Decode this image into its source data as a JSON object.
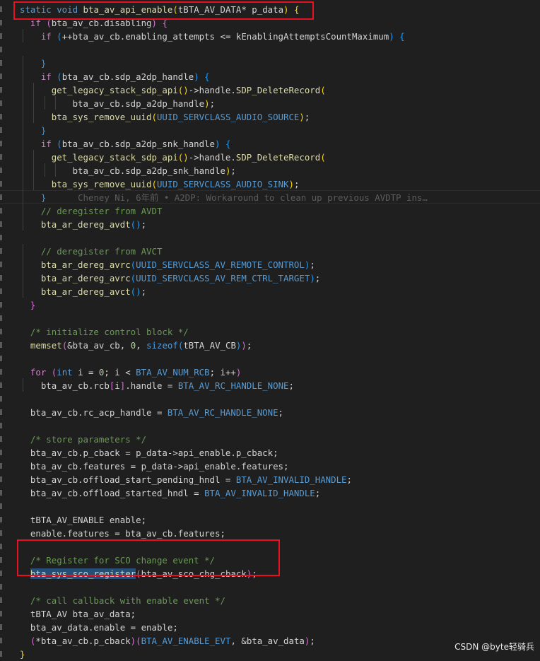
{
  "colors": {
    "background": "#1f1f1f",
    "text": "#d4d4d4",
    "keyword": "#569cd6",
    "control": "#c586c0",
    "function": "#dcdcaa",
    "comment": "#6a9955",
    "number": "#b5cea8",
    "macro": "#4fc1ff",
    "bracket1": "#ffd700",
    "bracket2": "#da70d6",
    "bracket3": "#179fff",
    "blame": "#5c5c5c",
    "annotation_box": "#e81123",
    "selection": "#264f78"
  },
  "code_lines": [
    [
      {
        "t": "static ",
        "c": "keyword"
      },
      {
        "t": "void ",
        "c": "keyword"
      },
      {
        "t": "bta_av_api_enable",
        "c": "function"
      },
      {
        "t": "(",
        "c": "bracket1"
      },
      {
        "t": "tBTA_AV_DATA",
        "c": "text"
      },
      {
        "t": "* p_data",
        "c": "text"
      },
      {
        "t": ")",
        "c": "bracket1"
      },
      {
        "t": " {",
        "c": "bracket1"
      }
    ],
    [
      {
        "t": "  if ",
        "c": "control"
      },
      {
        "t": "(",
        "c": "bracket2"
      },
      {
        "t": "bta_av_cb.disabling",
        "c": "text"
      },
      {
        "t": ") {",
        "c": "bracket2"
      }
    ],
    [
      {
        "t": "    if ",
        "c": "control"
      },
      {
        "t": "(",
        "c": "bracket3"
      },
      {
        "t": "++bta_av_cb.enabling_attempts <= kEnablingAttemptsCountMaximum",
        "c": "text"
      },
      {
        "t": ")",
        "c": "bracket3"
      },
      {
        "t": " {",
        "c": "bracket3"
      }
    ],
    [
      {
        "t": "",
        "c": "text"
      }
    ],
    [
      {
        "t": "    }",
        "c": "bracket3"
      }
    ],
    [
      {
        "t": "    if ",
        "c": "control"
      },
      {
        "t": "(",
        "c": "bracket3"
      },
      {
        "t": "bta_av_cb.sdp_a2dp_handle",
        "c": "text"
      },
      {
        "t": ")",
        "c": "bracket3"
      },
      {
        "t": " {",
        "c": "bracket3"
      }
    ],
    [
      {
        "t": "      get_legacy_stack_sdp_api",
        "c": "function"
      },
      {
        "t": "()",
        "c": "bracket1"
      },
      {
        "t": "->handle.",
        "c": "text"
      },
      {
        "t": "SDP_DeleteRecord",
        "c": "function"
      },
      {
        "t": "(",
        "c": "bracket1"
      }
    ],
    [
      {
        "t": "          bta_av_cb.sdp_a2dp_handle",
        "c": "text"
      },
      {
        "t": ")",
        "c": "bracket1"
      },
      {
        "t": ";",
        "c": "text"
      }
    ],
    [
      {
        "t": "      bta_sys_remove_uuid",
        "c": "function"
      },
      {
        "t": "(",
        "c": "bracket1"
      },
      {
        "t": "UUID_SERVCLASS_AUDIO_SOURCE",
        "c": "keyword"
      },
      {
        "t": ")",
        "c": "bracket1"
      },
      {
        "t": ";",
        "c": "text"
      }
    ],
    [
      {
        "t": "    }",
        "c": "bracket3"
      }
    ],
    [
      {
        "t": "    if ",
        "c": "control"
      },
      {
        "t": "(",
        "c": "bracket3"
      },
      {
        "t": "bta_av_cb.sdp_a2dp_snk_handle",
        "c": "text"
      },
      {
        "t": ")",
        "c": "bracket3"
      },
      {
        "t": " {",
        "c": "bracket3"
      }
    ],
    [
      {
        "t": "      get_legacy_stack_sdp_api",
        "c": "function"
      },
      {
        "t": "()",
        "c": "bracket1"
      },
      {
        "t": "->handle.",
        "c": "text"
      },
      {
        "t": "SDP_DeleteRecord",
        "c": "function"
      },
      {
        "t": "(",
        "c": "bracket1"
      }
    ],
    [
      {
        "t": "          bta_av_cb.sdp_a2dp_snk_handle",
        "c": "text"
      },
      {
        "t": ")",
        "c": "bracket1"
      },
      {
        "t": ";",
        "c": "text"
      }
    ],
    [
      {
        "t": "      bta_sys_remove_uuid",
        "c": "function"
      },
      {
        "t": "(",
        "c": "bracket1"
      },
      {
        "t": "UUID_SERVCLASS_AUDIO_SINK",
        "c": "keyword"
      },
      {
        "t": ")",
        "c": "bracket1"
      },
      {
        "t": ";",
        "c": "text"
      }
    ],
    [
      {
        "t": "    }",
        "c": "bracket3"
      },
      {
        "t": "      Cheney Ni, 6年前 • A2DP: Workaround to clean up previous AVDTP ins…",
        "c": "blame"
      }
    ],
    [
      {
        "t": "    // deregister from AVDT",
        "c": "comment"
      }
    ],
    [
      {
        "t": "    bta_ar_dereg_avdt",
        "c": "function"
      },
      {
        "t": "()",
        "c": "bracket3"
      },
      {
        "t": ";",
        "c": "text"
      }
    ],
    [
      {
        "t": "",
        "c": "text"
      }
    ],
    [
      {
        "t": "    // deregister from AVCT",
        "c": "comment"
      }
    ],
    [
      {
        "t": "    bta_ar_dereg_avrc",
        "c": "function"
      },
      {
        "t": "(",
        "c": "bracket3"
      },
      {
        "t": "UUID_SERVCLASS_AV_REMOTE_CONTROL",
        "c": "keyword"
      },
      {
        "t": ")",
        "c": "bracket3"
      },
      {
        "t": ";",
        "c": "text"
      }
    ],
    [
      {
        "t": "    bta_ar_dereg_avrc",
        "c": "function"
      },
      {
        "t": "(",
        "c": "bracket3"
      },
      {
        "t": "UUID_SERVCLASS_AV_REM_CTRL_TARGET",
        "c": "keyword"
      },
      {
        "t": ")",
        "c": "bracket3"
      },
      {
        "t": ";",
        "c": "text"
      }
    ],
    [
      {
        "t": "    bta_ar_dereg_avct",
        "c": "function"
      },
      {
        "t": "()",
        "c": "bracket3"
      },
      {
        "t": ";",
        "c": "text"
      }
    ],
    [
      {
        "t": "  }",
        "c": "bracket2"
      }
    ],
    [
      {
        "t": "",
        "c": "text"
      }
    ],
    [
      {
        "t": "  /* initialize control block */",
        "c": "comment"
      }
    ],
    [
      {
        "t": "  memset",
        "c": "function"
      },
      {
        "t": "(",
        "c": "bracket2"
      },
      {
        "t": "&bta_av_cb, ",
        "c": "text"
      },
      {
        "t": "0",
        "c": "number"
      },
      {
        "t": ", ",
        "c": "text"
      },
      {
        "t": "sizeof",
        "c": "keyword"
      },
      {
        "t": "(",
        "c": "bracket3"
      },
      {
        "t": "tBTA_AV_CB",
        "c": "text"
      },
      {
        "t": ")",
        "c": "bracket3"
      },
      {
        "t": ")",
        "c": "bracket2"
      },
      {
        "t": ";",
        "c": "text"
      }
    ],
    [
      {
        "t": "",
        "c": "text"
      }
    ],
    [
      {
        "t": "  for ",
        "c": "control"
      },
      {
        "t": "(",
        "c": "bracket2"
      },
      {
        "t": "int ",
        "c": "keyword"
      },
      {
        "t": "i = ",
        "c": "text"
      },
      {
        "t": "0",
        "c": "number"
      },
      {
        "t": "; i < ",
        "c": "text"
      },
      {
        "t": "BTA_AV_NUM_RCB",
        "c": "keyword"
      },
      {
        "t": "; i++",
        "c": "text"
      },
      {
        "t": ")",
        "c": "bracket2"
      }
    ],
    [
      {
        "t": "    bta_av_cb.rcb",
        "c": "text"
      },
      {
        "t": "[",
        "c": "bracket2"
      },
      {
        "t": "i",
        "c": "text"
      },
      {
        "t": "]",
        "c": "bracket2"
      },
      {
        "t": ".handle = ",
        "c": "text"
      },
      {
        "t": "BTA_AV_RC_HANDLE_NONE",
        "c": "keyword"
      },
      {
        "t": ";",
        "c": "text"
      }
    ],
    [
      {
        "t": "",
        "c": "text"
      }
    ],
    [
      {
        "t": "  bta_av_cb.rc_acp_handle = ",
        "c": "text"
      },
      {
        "t": "BTA_AV_RC_HANDLE_NONE",
        "c": "keyword"
      },
      {
        "t": ";",
        "c": "text"
      }
    ],
    [
      {
        "t": "",
        "c": "text"
      }
    ],
    [
      {
        "t": "  /* store parameters */",
        "c": "comment"
      }
    ],
    [
      {
        "t": "  bta_av_cb.p_cback = p_data->api_enable.p_cback;",
        "c": "text"
      }
    ],
    [
      {
        "t": "  bta_av_cb.features = p_data->api_enable.features;",
        "c": "text"
      }
    ],
    [
      {
        "t": "  bta_av_cb.offload_start_pending_hndl = ",
        "c": "text"
      },
      {
        "t": "BTA_AV_INVALID_HANDLE",
        "c": "keyword"
      },
      {
        "t": ";",
        "c": "text"
      }
    ],
    [
      {
        "t": "  bta_av_cb.offload_started_hndl = ",
        "c": "text"
      },
      {
        "t": "BTA_AV_INVALID_HANDLE",
        "c": "keyword"
      },
      {
        "t": ";",
        "c": "text"
      }
    ],
    [
      {
        "t": "",
        "c": "text"
      }
    ],
    [
      {
        "t": "  tBTA_AV_ENABLE enable;",
        "c": "text"
      }
    ],
    [
      {
        "t": "  enable.features = bta_av_cb.features;",
        "c": "text"
      }
    ],
    [
      {
        "t": "",
        "c": "text"
      }
    ],
    [
      {
        "t": "  /* Register for SCO change event */",
        "c": "comment"
      }
    ],
    [
      {
        "t": "  ",
        "c": "text"
      },
      {
        "t": "bta_sys_sco_register",
        "c": "function",
        "hl": true
      },
      {
        "t": "(",
        "c": "bracket2"
      },
      {
        "t": "bta_av_sco_chg_cback",
        "c": "text"
      },
      {
        "t": ")",
        "c": "bracket2"
      },
      {
        "t": ";",
        "c": "text"
      }
    ],
    [
      {
        "t": "",
        "c": "text"
      }
    ],
    [
      {
        "t": "  /* call callback with enable event */",
        "c": "comment"
      }
    ],
    [
      {
        "t": "  tBTA_AV bta_av_data;",
        "c": "text"
      }
    ],
    [
      {
        "t": "  bta_av_data.enable = enable;",
        "c": "text"
      }
    ],
    [
      {
        "t": "  ",
        "c": "text"
      },
      {
        "t": "(",
        "c": "bracket2"
      },
      {
        "t": "*bta_av_cb.p_cback",
        "c": "text"
      },
      {
        "t": ")",
        "c": "bracket2"
      },
      {
        "t": "(",
        "c": "bracket2"
      },
      {
        "t": "BTA_AV_ENABLE_EVT",
        "c": "keyword"
      },
      {
        "t": ", &bta_av_data",
        "c": "text"
      },
      {
        "t": ")",
        "c": "bracket2"
      },
      {
        "t": ";",
        "c": "text"
      }
    ],
    [
      {
        "t": "}",
        "c": "bracket1"
      }
    ]
  ],
  "watermark": "CSDN @byte轻骑兵"
}
